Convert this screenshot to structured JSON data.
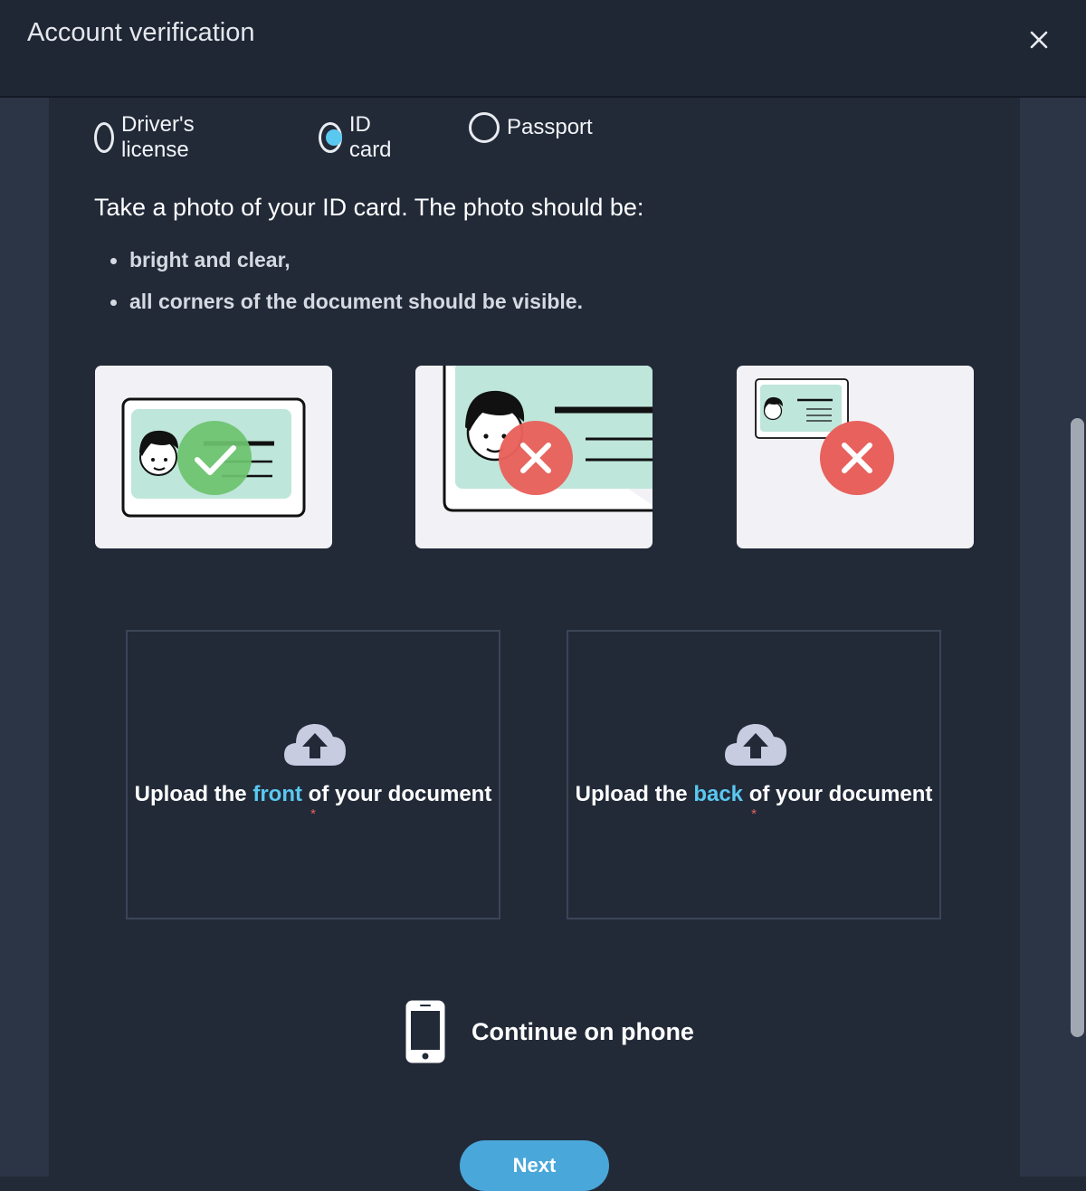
{
  "header": {
    "title": "Account verification",
    "close_icon": "close-icon"
  },
  "document_types": [
    {
      "label": "Driver's license",
      "selected": false
    },
    {
      "label": "ID card",
      "selected": true
    },
    {
      "label": "Passport",
      "selected": false
    }
  ],
  "instructions": {
    "heading": "Take a photo of your ID card. The photo should be:",
    "bullets": [
      "bright and clear,",
      "all corners of the document should be visible."
    ]
  },
  "examples": [
    {
      "status": "correct",
      "icon": "check-icon"
    },
    {
      "status": "incorrect",
      "icon": "x-icon"
    },
    {
      "status": "incorrect",
      "icon": "x-icon"
    }
  ],
  "uploads": {
    "front": {
      "prefix": "Upload the",
      "highlight": "front",
      "suffix": "of your document",
      "required_mark": "*",
      "icon": "cloud-upload-icon"
    },
    "back": {
      "prefix": "Upload the",
      "highlight": "back",
      "suffix": "of your document",
      "required_mark": "*",
      "icon": "cloud-upload-icon"
    }
  },
  "continue_on_phone": {
    "label": "Continue on phone",
    "icon": "phone-icon"
  },
  "next_button": {
    "label": "Next"
  },
  "colors": {
    "accent": "#5bc8f0",
    "button": "#4aa7d9",
    "ok": "#6cc36e",
    "error": "#e8615c",
    "card_bg": "#bfe6da",
    "background": "#222a38"
  }
}
